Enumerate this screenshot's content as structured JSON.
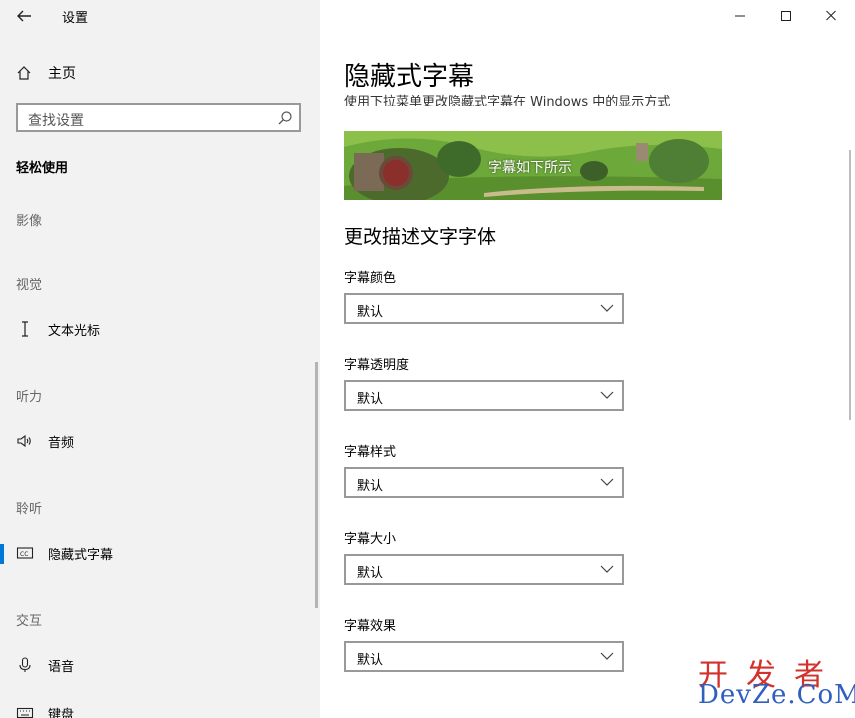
{
  "window": {
    "title": "设置"
  },
  "sidebar": {
    "home_label": "主页",
    "search_placeholder": "查找设置",
    "section_title": "轻松使用",
    "groups": [
      "影像",
      "视觉",
      "听力",
      "聆听",
      "交互"
    ],
    "items": [
      {
        "label": "文本光标",
        "icon": "text-cursor-icon"
      },
      {
        "label": "音频",
        "icon": "speaker-icon"
      },
      {
        "label": "隐藏式字幕",
        "icon": "closed-captions-icon",
        "selected": true
      },
      {
        "label": "语音",
        "icon": "microphone-icon"
      },
      {
        "label": "键盘",
        "icon": "keyboard-icon"
      }
    ],
    "selection_color": "#0078d7"
  },
  "main": {
    "page_title": "隐藏式字幕",
    "subtitle": "使用下拉菜单更改隐藏式字幕在 Windows 中的显示方式",
    "preview_caption": "字幕如下所示",
    "section_heading": "更改描述文字字体",
    "fields": [
      {
        "label": "字幕颜色",
        "value": "默认"
      },
      {
        "label": "字幕透明度",
        "value": "默认"
      },
      {
        "label": "字幕样式",
        "value": "默认"
      },
      {
        "label": "字幕大小",
        "value": "默认"
      },
      {
        "label": "字幕效果",
        "value": "默认"
      }
    ]
  },
  "watermark": {
    "top": "开发者",
    "bottom": "DevZe.CoM"
  }
}
